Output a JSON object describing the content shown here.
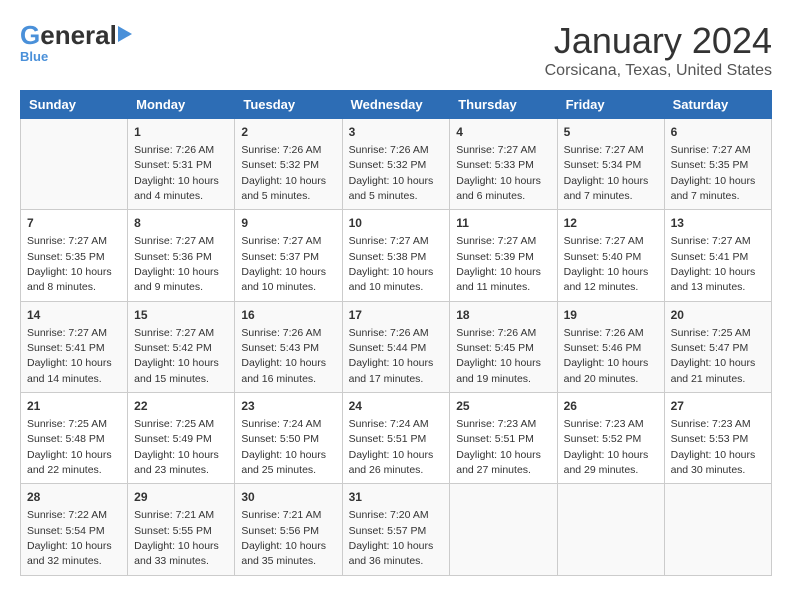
{
  "logo": {
    "general": "General",
    "blue": "Blue"
  },
  "title": "January 2024",
  "subtitle": "Corsicana, Texas, United States",
  "headers": [
    "Sunday",
    "Monday",
    "Tuesday",
    "Wednesday",
    "Thursday",
    "Friday",
    "Saturday"
  ],
  "weeks": [
    [
      {
        "num": "",
        "sunrise": "",
        "sunset": "",
        "daylight": ""
      },
      {
        "num": "1",
        "sunrise": "Sunrise: 7:26 AM",
        "sunset": "Sunset: 5:31 PM",
        "daylight": "Daylight: 10 hours and 4 minutes."
      },
      {
        "num": "2",
        "sunrise": "Sunrise: 7:26 AM",
        "sunset": "Sunset: 5:32 PM",
        "daylight": "Daylight: 10 hours and 5 minutes."
      },
      {
        "num": "3",
        "sunrise": "Sunrise: 7:26 AM",
        "sunset": "Sunset: 5:32 PM",
        "daylight": "Daylight: 10 hours and 5 minutes."
      },
      {
        "num": "4",
        "sunrise": "Sunrise: 7:27 AM",
        "sunset": "Sunset: 5:33 PM",
        "daylight": "Daylight: 10 hours and 6 minutes."
      },
      {
        "num": "5",
        "sunrise": "Sunrise: 7:27 AM",
        "sunset": "Sunset: 5:34 PM",
        "daylight": "Daylight: 10 hours and 7 minutes."
      },
      {
        "num": "6",
        "sunrise": "Sunrise: 7:27 AM",
        "sunset": "Sunset: 5:35 PM",
        "daylight": "Daylight: 10 hours and 7 minutes."
      }
    ],
    [
      {
        "num": "7",
        "sunrise": "Sunrise: 7:27 AM",
        "sunset": "Sunset: 5:35 PM",
        "daylight": "Daylight: 10 hours and 8 minutes."
      },
      {
        "num": "8",
        "sunrise": "Sunrise: 7:27 AM",
        "sunset": "Sunset: 5:36 PM",
        "daylight": "Daylight: 10 hours and 9 minutes."
      },
      {
        "num": "9",
        "sunrise": "Sunrise: 7:27 AM",
        "sunset": "Sunset: 5:37 PM",
        "daylight": "Daylight: 10 hours and 10 minutes."
      },
      {
        "num": "10",
        "sunrise": "Sunrise: 7:27 AM",
        "sunset": "Sunset: 5:38 PM",
        "daylight": "Daylight: 10 hours and 10 minutes."
      },
      {
        "num": "11",
        "sunrise": "Sunrise: 7:27 AM",
        "sunset": "Sunset: 5:39 PM",
        "daylight": "Daylight: 10 hours and 11 minutes."
      },
      {
        "num": "12",
        "sunrise": "Sunrise: 7:27 AM",
        "sunset": "Sunset: 5:40 PM",
        "daylight": "Daylight: 10 hours and 12 minutes."
      },
      {
        "num": "13",
        "sunrise": "Sunrise: 7:27 AM",
        "sunset": "Sunset: 5:41 PM",
        "daylight": "Daylight: 10 hours and 13 minutes."
      }
    ],
    [
      {
        "num": "14",
        "sunrise": "Sunrise: 7:27 AM",
        "sunset": "Sunset: 5:41 PM",
        "daylight": "Daylight: 10 hours and 14 minutes."
      },
      {
        "num": "15",
        "sunrise": "Sunrise: 7:27 AM",
        "sunset": "Sunset: 5:42 PM",
        "daylight": "Daylight: 10 hours and 15 minutes."
      },
      {
        "num": "16",
        "sunrise": "Sunrise: 7:26 AM",
        "sunset": "Sunset: 5:43 PM",
        "daylight": "Daylight: 10 hours and 16 minutes."
      },
      {
        "num": "17",
        "sunrise": "Sunrise: 7:26 AM",
        "sunset": "Sunset: 5:44 PM",
        "daylight": "Daylight: 10 hours and 17 minutes."
      },
      {
        "num": "18",
        "sunrise": "Sunrise: 7:26 AM",
        "sunset": "Sunset: 5:45 PM",
        "daylight": "Daylight: 10 hours and 19 minutes."
      },
      {
        "num": "19",
        "sunrise": "Sunrise: 7:26 AM",
        "sunset": "Sunset: 5:46 PM",
        "daylight": "Daylight: 10 hours and 20 minutes."
      },
      {
        "num": "20",
        "sunrise": "Sunrise: 7:25 AM",
        "sunset": "Sunset: 5:47 PM",
        "daylight": "Daylight: 10 hours and 21 minutes."
      }
    ],
    [
      {
        "num": "21",
        "sunrise": "Sunrise: 7:25 AM",
        "sunset": "Sunset: 5:48 PM",
        "daylight": "Daylight: 10 hours and 22 minutes."
      },
      {
        "num": "22",
        "sunrise": "Sunrise: 7:25 AM",
        "sunset": "Sunset: 5:49 PM",
        "daylight": "Daylight: 10 hours and 23 minutes."
      },
      {
        "num": "23",
        "sunrise": "Sunrise: 7:24 AM",
        "sunset": "Sunset: 5:50 PM",
        "daylight": "Daylight: 10 hours and 25 minutes."
      },
      {
        "num": "24",
        "sunrise": "Sunrise: 7:24 AM",
        "sunset": "Sunset: 5:51 PM",
        "daylight": "Daylight: 10 hours and 26 minutes."
      },
      {
        "num": "25",
        "sunrise": "Sunrise: 7:23 AM",
        "sunset": "Sunset: 5:51 PM",
        "daylight": "Daylight: 10 hours and 27 minutes."
      },
      {
        "num": "26",
        "sunrise": "Sunrise: 7:23 AM",
        "sunset": "Sunset: 5:52 PM",
        "daylight": "Daylight: 10 hours and 29 minutes."
      },
      {
        "num": "27",
        "sunrise": "Sunrise: 7:23 AM",
        "sunset": "Sunset: 5:53 PM",
        "daylight": "Daylight: 10 hours and 30 minutes."
      }
    ],
    [
      {
        "num": "28",
        "sunrise": "Sunrise: 7:22 AM",
        "sunset": "Sunset: 5:54 PM",
        "daylight": "Daylight: 10 hours and 32 minutes."
      },
      {
        "num": "29",
        "sunrise": "Sunrise: 7:21 AM",
        "sunset": "Sunset: 5:55 PM",
        "daylight": "Daylight: 10 hours and 33 minutes."
      },
      {
        "num": "30",
        "sunrise": "Sunrise: 7:21 AM",
        "sunset": "Sunset: 5:56 PM",
        "daylight": "Daylight: 10 hours and 35 minutes."
      },
      {
        "num": "31",
        "sunrise": "Sunrise: 7:20 AM",
        "sunset": "Sunset: 5:57 PM",
        "daylight": "Daylight: 10 hours and 36 minutes."
      },
      {
        "num": "",
        "sunrise": "",
        "sunset": "",
        "daylight": ""
      },
      {
        "num": "",
        "sunrise": "",
        "sunset": "",
        "daylight": ""
      },
      {
        "num": "",
        "sunrise": "",
        "sunset": "",
        "daylight": ""
      }
    ]
  ]
}
